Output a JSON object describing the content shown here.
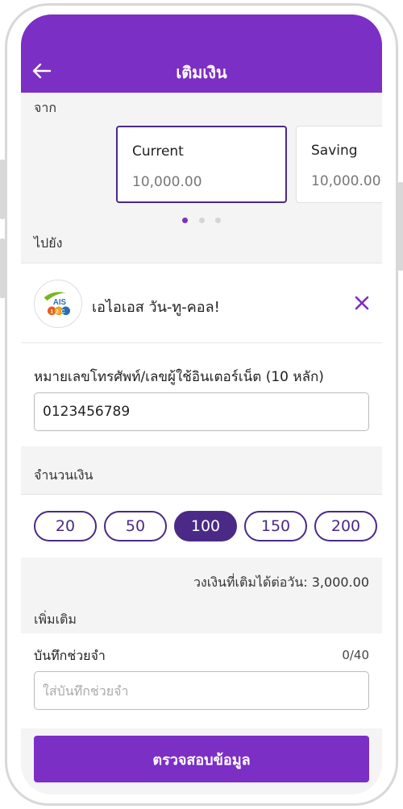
{
  "header": {
    "title": "เติมเงิน",
    "back_icon": "arrow-left-icon"
  },
  "from": {
    "label": "จาก",
    "accounts": [
      {
        "name": "Current",
        "balance": "10,000.00",
        "selected": true
      },
      {
        "name": "Saving",
        "balance": "10,000.00",
        "selected": false
      }
    ],
    "page_count": 3,
    "active_page": 1
  },
  "to": {
    "label": "ไปยัง",
    "provider": {
      "logo_text": "AIS",
      "logo_subtext": "12C",
      "name": "เอไอเอส วัน-ทู-คอล!"
    }
  },
  "phone": {
    "label": "หมายเลขโทรศัพท์/เลขผู้ใช้อินเตอร์เน็ต (10 หลัก)",
    "value": "0123456789"
  },
  "amount": {
    "label": "จำนวนเงิน",
    "options": [
      "20",
      "50",
      "100",
      "150",
      "200"
    ],
    "selected": "100"
  },
  "limit_text": "วงเงินที่เติมได้ต่อวัน: 3,000.00",
  "more": {
    "label": "เพิ่มเติม",
    "memo_label": "บันทึกช่วยจำ",
    "memo_count": "0/40",
    "memo_placeholder": "ใส่บันทึกช่วยจำ",
    "memo_value": ""
  },
  "submit_label": "ตรวจสอบข้อมูล",
  "colors": {
    "brand": "#7b2fc4",
    "accent_dark": "#4a2a86"
  }
}
